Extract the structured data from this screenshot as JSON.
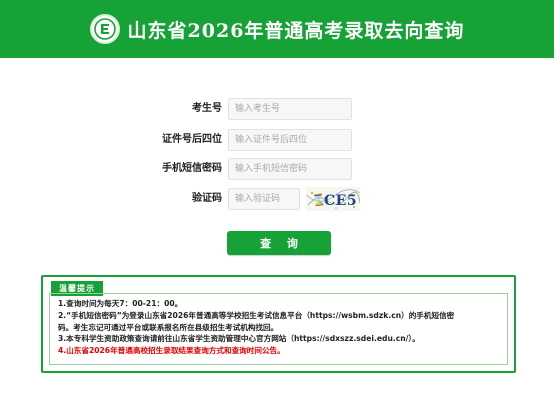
{
  "header": {
    "title": "山东省2026年普通高考录取去向查询"
  },
  "form": {
    "exam_no": {
      "label": "考生号",
      "placeholder": "输入考生号"
    },
    "id_last4": {
      "label": "证件号后四位",
      "placeholder": "输入证件号后四位"
    },
    "sms_password": {
      "label": "手机短信密码",
      "placeholder": "输入手机短信密码"
    },
    "captcha": {
      "label": "验证码",
      "placeholder": "输入验证码",
      "image_text": "CE5"
    },
    "submit_label": "查 询"
  },
  "notice": {
    "title": "温馨提示",
    "items": [
      "1.查询时间为每天7：00-21：00。",
      "2.“手机短信密码”为登录山东省2026年普通高等学校招生考试信息平台（https://wsbm.sdzk.cn）的手机短信密",
      "码。考生忘记可通过平台或联系报名所在县级招生考试机构找回。",
      "3.本专科学生资助政策查询请前往山东省学生资助管理中心官方网站（https://sdxszz.sdei.edu.cn/）。",
      "4.山东省2026年普通高校招生录取结果查询方式和查询时间公告。"
    ]
  },
  "colors": {
    "brand_green": "#16a236",
    "notice_red": "#e60000"
  },
  "icons": {
    "logo": "shandong-exam-logo-icon"
  }
}
